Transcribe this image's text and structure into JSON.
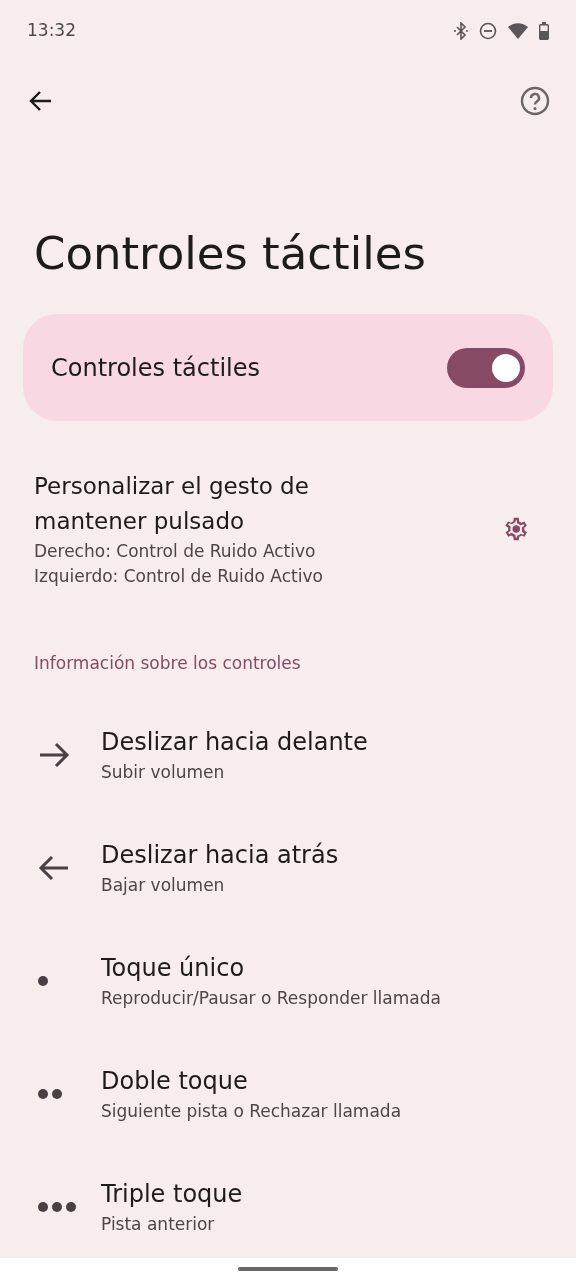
{
  "status_bar": {
    "time": "13:32"
  },
  "title": "Controles táctiles",
  "main_toggle": {
    "label": "Controles táctiles",
    "on": true
  },
  "long_press": {
    "title": "Personalizar el gesto de mantener pulsado",
    "lines": [
      "Derecho: Control de Ruido Activo",
      "Izquierdo: Control de Ruido Activo"
    ]
  },
  "section_header": "Información sobre los controles",
  "gestures": [
    {
      "kind": "swipe-forward",
      "title": "Deslizar hacia delante",
      "subtitle": "Subir volumen"
    },
    {
      "kind": "swipe-back",
      "title": "Deslizar hacia atrás",
      "subtitle": "Bajar volumen"
    },
    {
      "kind": "tap-1",
      "title": "Toque único",
      "subtitle": "Reproducir/Pausar o Responder llamada"
    },
    {
      "kind": "tap-2",
      "title": "Doble toque",
      "subtitle": "Siguiente pista o Rechazar llamada"
    },
    {
      "kind": "tap-3",
      "title": "Triple toque",
      "subtitle": "Pista anterior"
    }
  ]
}
